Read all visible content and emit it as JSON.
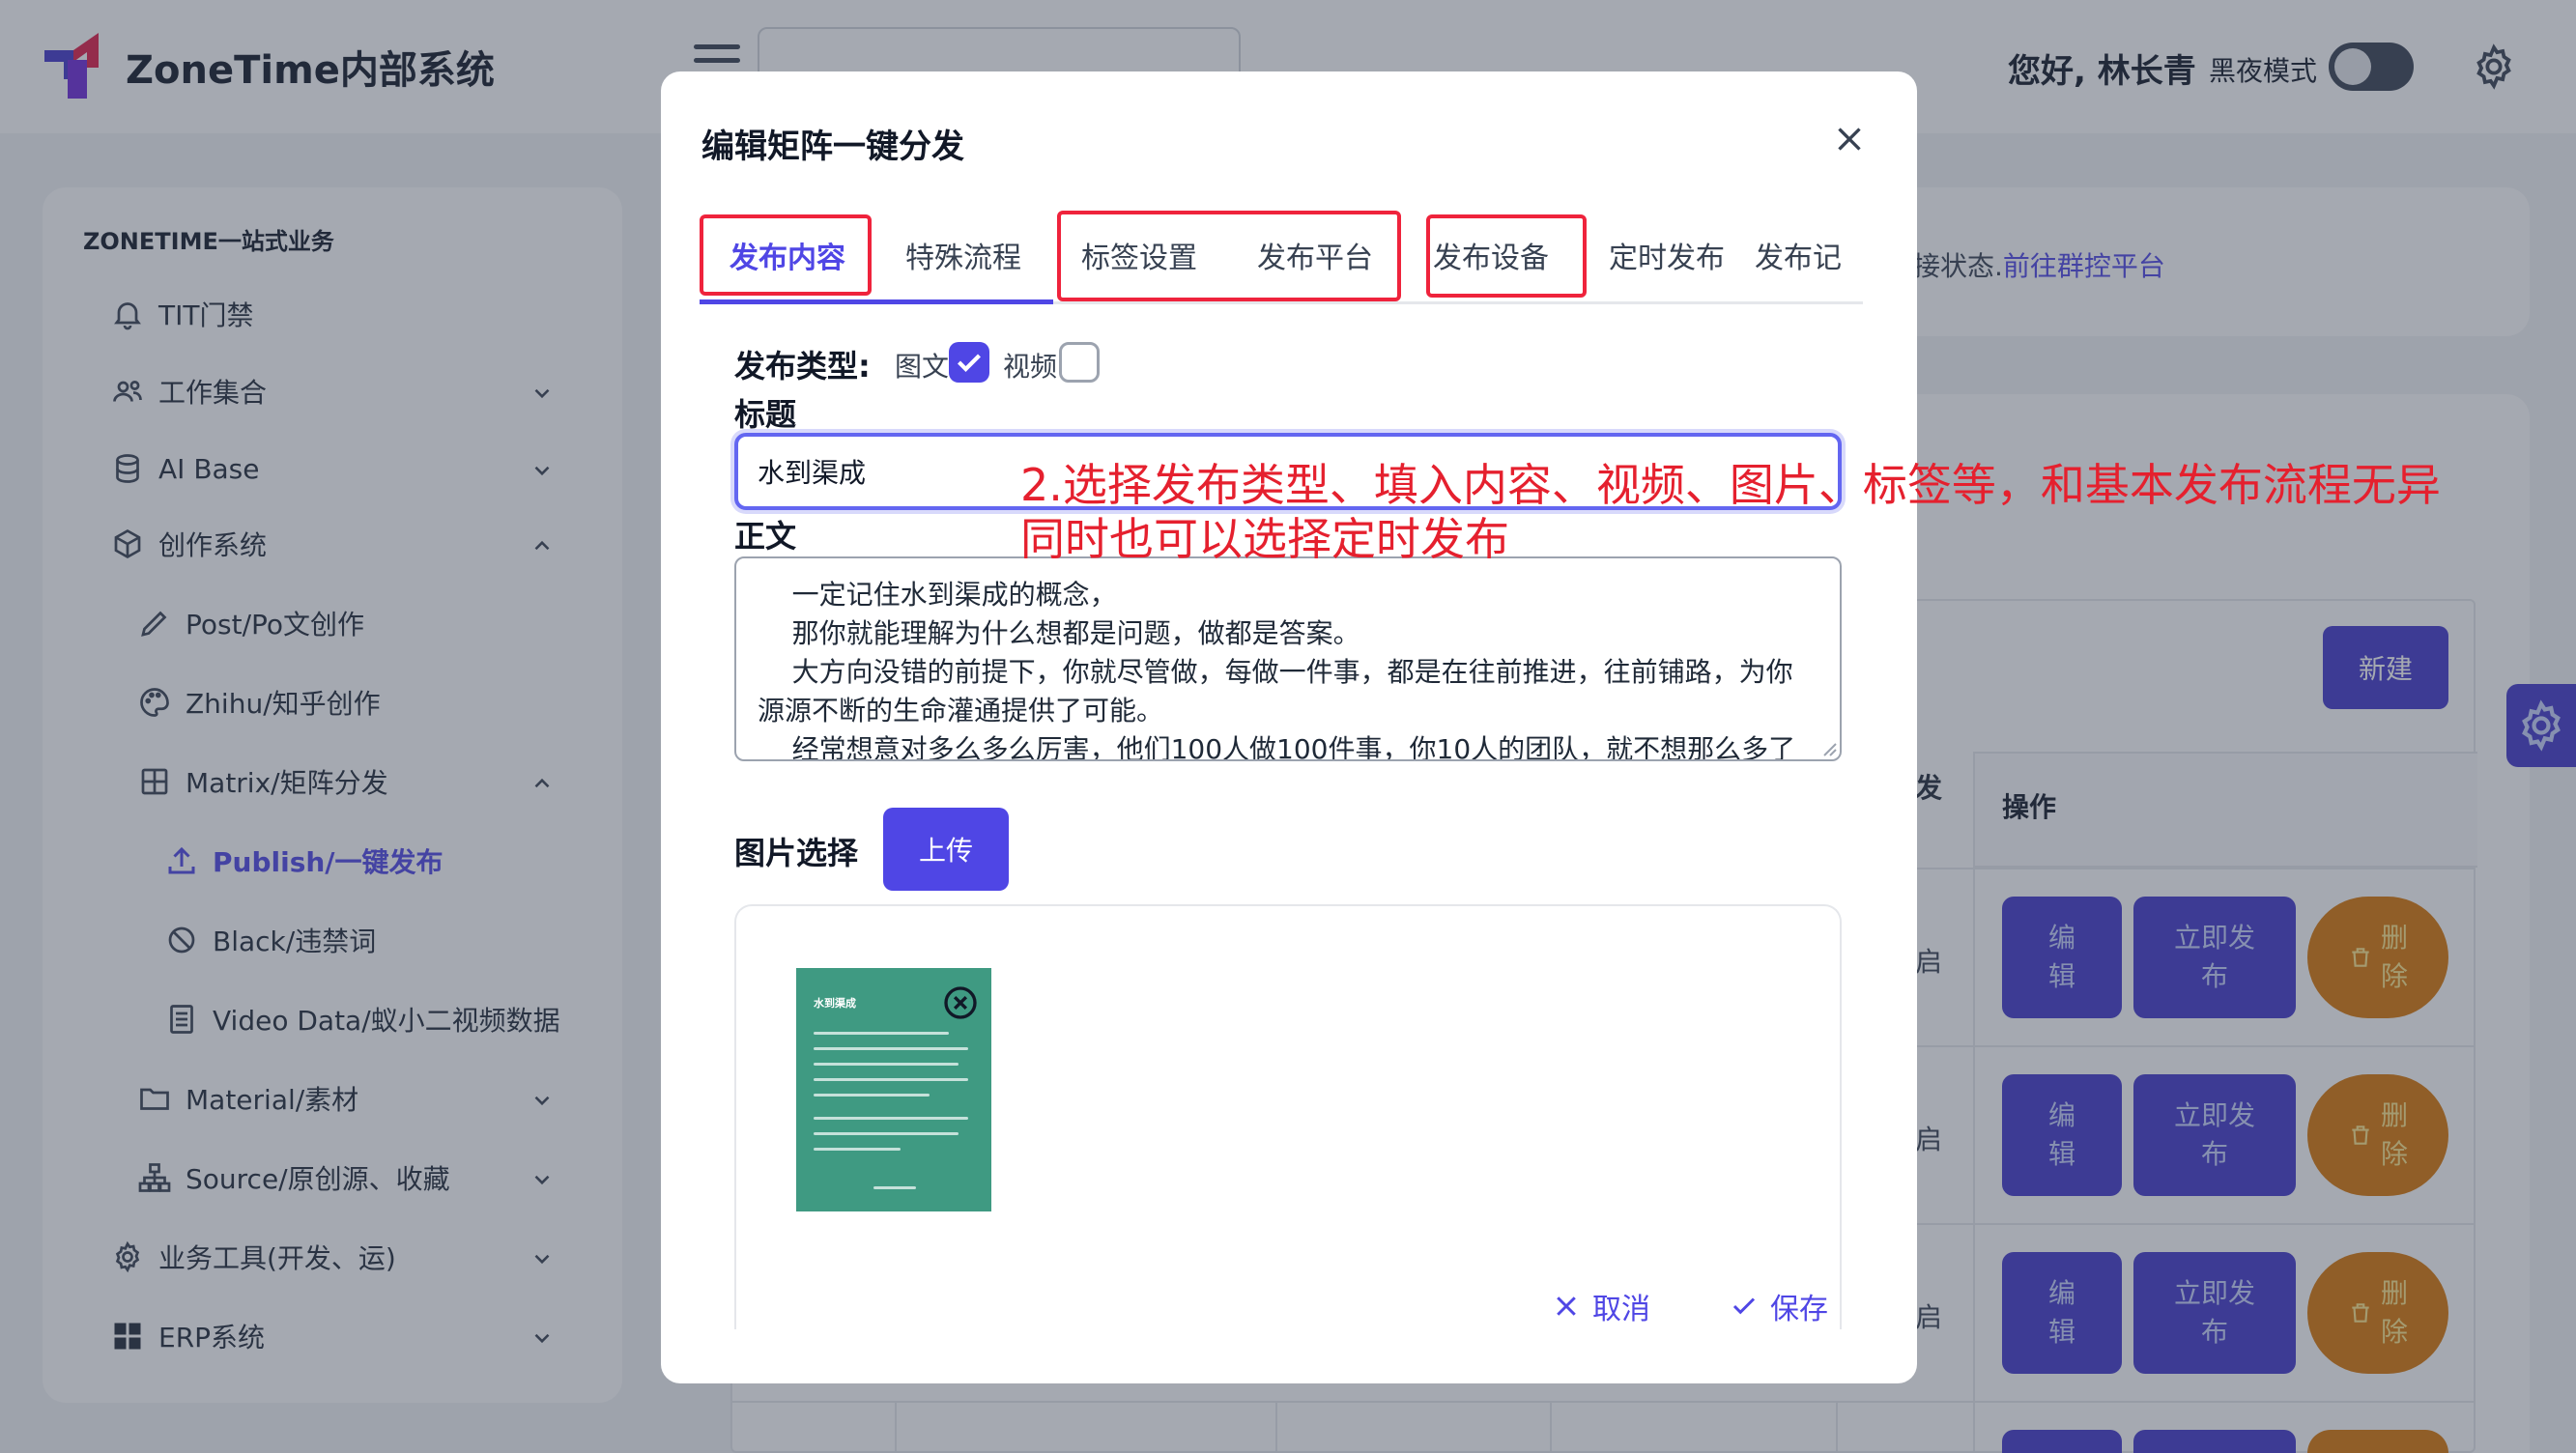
{
  "app": {
    "brand": "ZoneTime内部系统",
    "greeting": "您好, 林长青",
    "night_mode_label": "黑夜模式"
  },
  "sidebar": {
    "section": "ZONETIME一站式业务",
    "items": [
      {
        "label": "TIT门禁",
        "icon": "bell-icon"
      },
      {
        "label": "工作集合",
        "icon": "users-icon"
      },
      {
        "label": "AI Base",
        "icon": "database-icon"
      },
      {
        "label": "创作系统",
        "icon": "cube-icon"
      },
      {
        "label": "Post/Po文创作",
        "icon": "pencil-icon"
      },
      {
        "label": "Zhihu/知乎创作",
        "icon": "palette-icon"
      },
      {
        "label": "Matrix/矩阵分发",
        "icon": "grid-icon"
      },
      {
        "label": "Publish/一键发布",
        "icon": "upload-icon",
        "active": true
      },
      {
        "label": "Black/违禁词",
        "icon": "ban-icon"
      },
      {
        "label": "Video Data/蚁小二视频数据",
        "icon": "document-icon"
      },
      {
        "label": "Material/素材",
        "icon": "folder-icon"
      },
      {
        "label": "Source/原创源、收藏",
        "icon": "sitemap-icon"
      },
      {
        "label": "业务工具(开发、运)",
        "icon": "gear-icon"
      },
      {
        "label": "ERP系统",
        "icon": "windows-icon"
      }
    ]
  },
  "background": {
    "connection_text": "接状态.",
    "connection_link": "前往群控平台",
    "new_button": "新建",
    "col_partial": "发",
    "col_operation": "操作",
    "row_status": "启",
    "edit_label": "编\n辑",
    "publish_label": "立即发\n布",
    "delete_label": "删\n除"
  },
  "modal": {
    "title": "编辑矩阵一键分发",
    "tabs": [
      "发布内容",
      "特殊流程",
      "标签设置",
      "发布平台",
      "发布设备",
      "定时发布",
      "发布记"
    ],
    "publish_type_label": "发布类型:",
    "type_image_text": "图文",
    "type_video": "视频",
    "title_label": "标题",
    "title_value": "水到渠成",
    "body_label": "正文",
    "body_value": "    一定记住水到渠成的概念，\n    那你就能理解为什么想都是问题，做都是答案。\n    大方向没错的前提下，你就尽管做，每做一件事，都是在往前推进，往前铺路，为你源源不断的生命灌通提供了可能。\n    经常想意对多么多么厉害，他们100人做100件事，你10人的团队，就不想那么多了",
    "image_select_label": "图片选择",
    "upload_button": "上传",
    "thumb_title": "水到渠成",
    "cancel_button": "取消",
    "save_button": "保存"
  },
  "annotation": {
    "line1": "2.选择发布类型、填入内容、视频、图片、标签等，和基本发布流程无异",
    "line2": "同时也可以选择定时发布"
  },
  "colors": {
    "accent": "#4f46e5",
    "highlight": "#ef233c",
    "annotation": "#e5202e",
    "danger": "#d97706"
  }
}
